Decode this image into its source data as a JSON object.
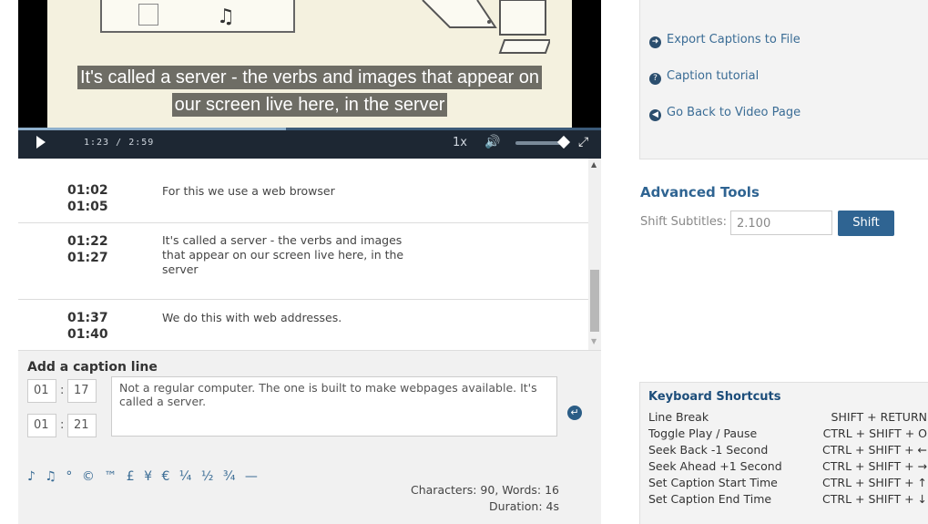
{
  "video": {
    "caption_line1": "It's called a server - the verbs and images that appear on",
    "caption_line2": "our screen live here, in the server",
    "time_current": "1:23",
    "time_sep": "/",
    "time_total": "2:59",
    "speed": "1x",
    "progress": 0.46
  },
  "captions": [
    {
      "start": "01:02",
      "end": "01:05",
      "text": "For this we use a web browser"
    },
    {
      "start": "01:22",
      "end": "01:27",
      "text": "It's called a server - the verbs and images that appear on our screen live here, in the server"
    },
    {
      "start": "01:37",
      "end": "01:40",
      "text": "We do this with web addresses."
    }
  ],
  "add_caption": {
    "heading": "Add a caption line",
    "start_min": "01",
    "start_sec": "17",
    "end_min": "01",
    "end_sec": "21",
    "text": "Not a regular computer. The one is built to make webpages available. It's called a server.",
    "specials": "♪ ♫ ° © ™ £ ¥ € ¼ ½ ¾ —",
    "stats": "Characters: 90, Words: 16",
    "duration": "Duration: 4s"
  },
  "panel_links": [
    {
      "icon": "export-icon",
      "label": "Export Captions to File"
    },
    {
      "icon": "help-icon",
      "label": "Caption tutorial"
    },
    {
      "icon": "back-icon",
      "label": "Go Back to Video Page"
    }
  ],
  "advanced": {
    "title": "Advanced Tools",
    "shift_label": "Shift Subtitles:",
    "shift_placeholder": "2.100",
    "shift_button": "Shift"
  },
  "shortcuts": {
    "title": "Keyboard Shortcuts",
    "items": [
      {
        "label": "Line Break",
        "keys": "SHIFT + RETURN"
      },
      {
        "label": "Toggle Play / Pause",
        "keys": "CTRL + SHIFT + O"
      },
      {
        "label": "Seek Back -1 Second",
        "keys": "CTRL + SHIFT + ←"
      },
      {
        "label": "Seek Ahead +1 Second",
        "keys": "CTRL + SHIFT + →"
      },
      {
        "label": "Set Caption Start Time",
        "keys": "CTRL + SHIFT + ↑"
      },
      {
        "label": "Set Caption End Time",
        "keys": "CTRL + SHIFT + ↓"
      }
    ]
  }
}
